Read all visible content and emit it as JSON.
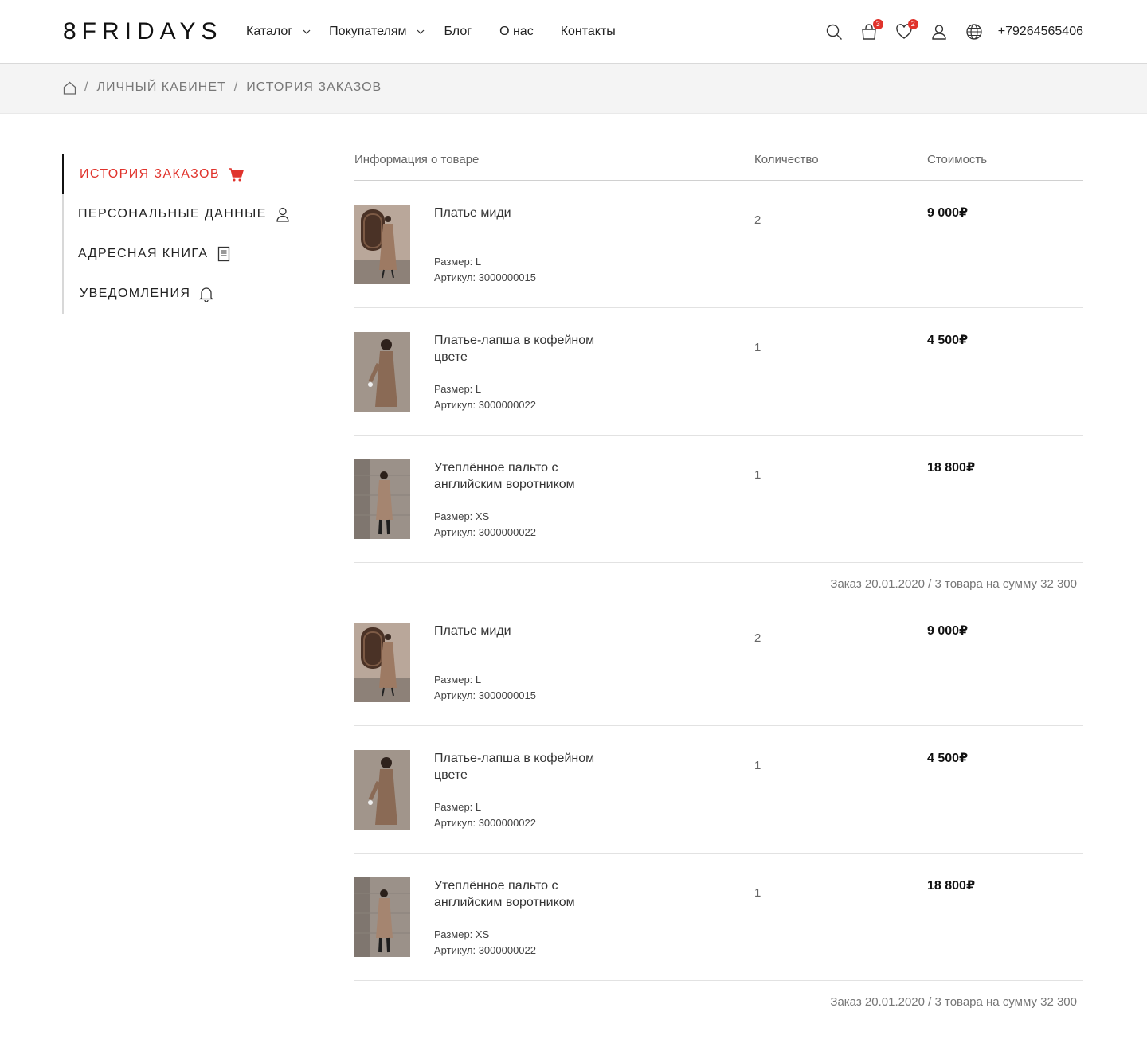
{
  "header": {
    "logo": "8FRIDAYS",
    "nav": [
      {
        "label": "Каталог",
        "dropdown": true
      },
      {
        "label": "Покупателям",
        "dropdown": true
      },
      {
        "label": "Блог",
        "dropdown": false
      },
      {
        "label": "О нас",
        "dropdown": false
      },
      {
        "label": "Контакты",
        "dropdown": false
      }
    ],
    "cart_count": "3",
    "wishlist_count": "2",
    "phone": "+79264565406"
  },
  "breadcrumb": {
    "items": [
      "ЛИЧНЫЙ КАБИНЕТ",
      "ИСТОРИЯ ЗАКАЗОВ"
    ],
    "separator": "/"
  },
  "sidebar": {
    "items": [
      {
        "label": "ИСТОРИЯ ЗАКАЗОВ",
        "icon": "cart-icon",
        "active": true
      },
      {
        "label": "ПЕРСОНАЛЬНЫЕ ДАННЫЕ",
        "icon": "user-icon",
        "active": false
      },
      {
        "label": "АДРЕСНАЯ КНИГА",
        "icon": "book-icon",
        "active": false
      },
      {
        "label": "УВЕДОМЛЕНИЯ",
        "icon": "bell-icon",
        "active": false
      }
    ]
  },
  "table": {
    "headers": {
      "info": "Информация о товаре",
      "qty": "Количество",
      "price": "Стоимость"
    }
  },
  "orders": [
    {
      "items": [
        {
          "name": "Платье миди",
          "size": "Размер: L",
          "sku": "Артикул: 3000000015",
          "qty": "2",
          "price": "9 000₽"
        },
        {
          "name": "Платье-лапша в кофейном цвете",
          "size": "Размер: L",
          "sku": "Артикул: 3000000022",
          "qty": "1",
          "price": "4 500₽"
        },
        {
          "name": "Утеплённое пальто с английским воротником",
          "size": "Размер: XS",
          "sku": "Артикул: 3000000022",
          "qty": "1",
          "price": "18 800₽"
        }
      ],
      "summary": "Заказ 20.01.2020 / 3 товара на сумму 32 300"
    },
    {
      "items": [
        {
          "name": "Платье миди",
          "size": "Размер: L",
          "sku": "Артикул: 3000000015",
          "qty": "2",
          "price": "9 000₽"
        },
        {
          "name": "Платье-лапша в кофейном цвете",
          "size": "Размер: L",
          "sku": "Артикул: 3000000022",
          "qty": "1",
          "price": "4 500₽"
        },
        {
          "name": "Утеплённое пальто с английским воротником",
          "size": "Размер: XS",
          "sku": "Артикул: 3000000022",
          "qty": "1",
          "price": "18 800₽"
        }
      ],
      "summary": "Заказ 20.01.2020 / 3 товара на сумму 32 300"
    }
  ],
  "colors": {
    "accent": "#e0332c",
    "text": "#222222",
    "muted": "#777777",
    "crumb_bg": "#f4f4f4"
  }
}
